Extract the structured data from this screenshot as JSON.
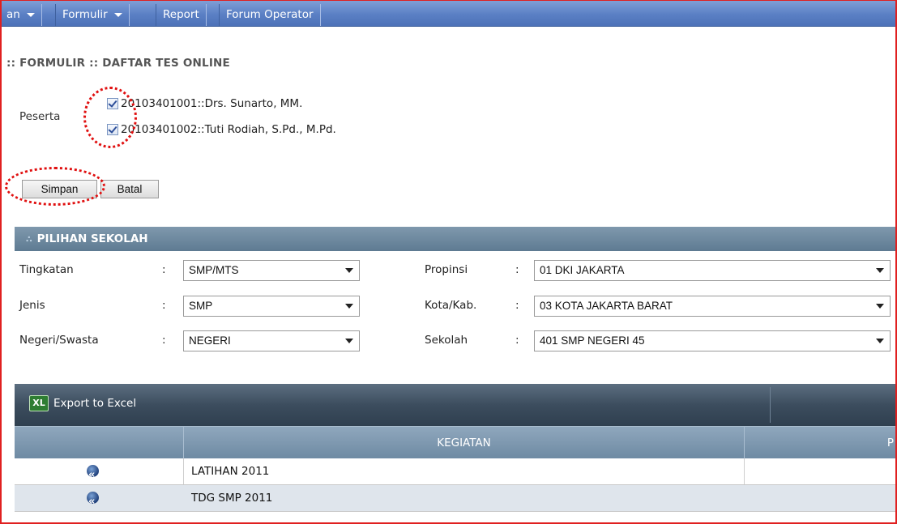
{
  "menu": {
    "items": [
      {
        "label": "an",
        "dropdown": true
      },
      {
        "label": "Formulir",
        "dropdown": true
      },
      {
        "label": "Report",
        "dropdown": false
      },
      {
        "label": "Forum Operator",
        "dropdown": false
      }
    ]
  },
  "page": {
    "title": ":: FORMULIR :: DAFTAR TES ONLINE"
  },
  "peserta": {
    "label": "Peserta",
    "items": [
      {
        "text": "20103401001::Drs. Sunarto, MM.",
        "checked": true
      },
      {
        "text": "20103401002::Tuti Rodiah, S.Pd., M.Pd.",
        "checked": true
      }
    ]
  },
  "buttons": {
    "save": "Simpan",
    "cancel": "Batal"
  },
  "pilihan_sekolah": {
    "title": "PILIHAN SEKOLAH",
    "colon": ":",
    "tingkatan": {
      "label": "Tingkatan",
      "value": "SMP/MTS"
    },
    "jenis": {
      "label": "Jenis",
      "value": "SMP"
    },
    "negeri_swasta": {
      "label": "Negeri/Swasta",
      "value": "NEGERI"
    },
    "propinsi": {
      "label": "Propinsi",
      "value": "01 DKI JAKARTA"
    },
    "kota": {
      "label": "Kota/Kab.",
      "value": "03 KOTA JAKARTA BARAT"
    },
    "sekolah": {
      "label": "Sekolah",
      "value": "401 SMP NEGERI 45"
    }
  },
  "grid": {
    "export_label": "Export to Excel",
    "export_icon": "XL",
    "columns": [
      "",
      "KEGIATAN",
      "P"
    ],
    "rows": [
      {
        "kegiatan": "LATIHAN 2011",
        "icon": "rewind-icon"
      },
      {
        "kegiatan": "TDG SMP 2011",
        "icon": "rewind-icon"
      }
    ]
  },
  "colors": {
    "menu_bar": "#5a7fc4",
    "panel_header": "#6a859b",
    "annotation": "#e01010",
    "row_alt": "#dfe5ec"
  }
}
